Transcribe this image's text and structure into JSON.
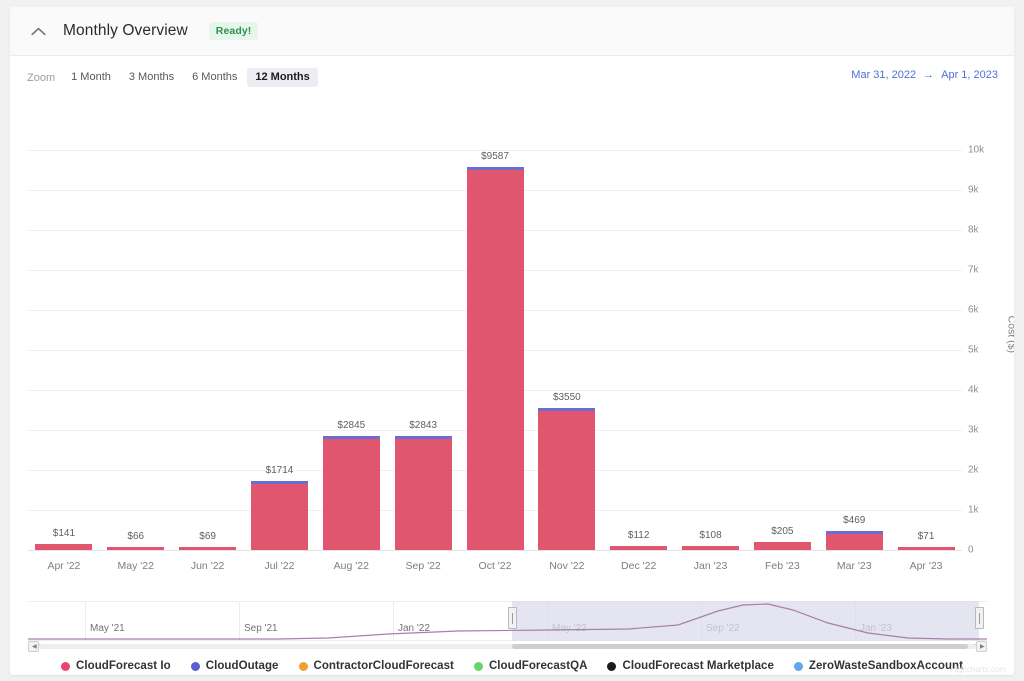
{
  "header": {
    "title": "Monthly Overview",
    "status": "Ready!",
    "collapse_icon": "chevron-up-icon"
  },
  "toolbar": {
    "zoom_label": "Zoom",
    "zoom_options": [
      {
        "label": "1 Month",
        "active": false
      },
      {
        "label": "3 Months",
        "active": false
      },
      {
        "label": "6 Months",
        "active": false
      },
      {
        "label": "12 Months",
        "active": true
      }
    ],
    "range_start": "Mar 31, 2022",
    "range_arrow": "→",
    "range_end": "Apr 1, 2023"
  },
  "chart_data": {
    "type": "bar",
    "title": "",
    "subtitle": "",
    "xlabel": "",
    "ylabel": "Cost ($)",
    "ylim": [
      0,
      10000
    ],
    "yticks": [
      "0",
      "1k",
      "2k",
      "3k",
      "4k",
      "5k",
      "6k",
      "7k",
      "8k",
      "9k",
      "10k"
    ],
    "grid": true,
    "legend_position": "bottom",
    "categories": [
      "Apr '22",
      "May '22",
      "Jun '22",
      "Jul '22",
      "Aug '22",
      "Sep '22",
      "Oct '22",
      "Nov '22",
      "Dec '22",
      "Jan '23",
      "Feb '23",
      "Mar '23",
      "Apr '23"
    ],
    "values": [
      141,
      66,
      69,
      1714,
      2845,
      2843,
      9587,
      3550,
      112,
      108,
      205,
      469,
      71
    ],
    "data_labels": [
      "$141",
      "$66",
      "$69",
      "$1714",
      "$2845",
      "$2843",
      "$9587",
      "$3550",
      "$112",
      "$108",
      "$205",
      "$469",
      "$71"
    ],
    "series": [
      {
        "name": "CloudForecast Io",
        "color": "#e0566f"
      },
      {
        "name": "CloudOutage",
        "color": "#6a6ed0"
      },
      {
        "name": "ContractorCloudForecast",
        "color": "#f0a02e"
      },
      {
        "name": "CloudForecastQA",
        "color": "#69d36c"
      },
      {
        "name": "CloudForecast Marketplace",
        "color": "#1c1c1e"
      },
      {
        "name": "ZeroWasteSandboxAccount",
        "color": "#61a6ea"
      }
    ]
  },
  "navigator": {
    "ticks": [
      "May '21",
      "Sep '21",
      "Jan '22",
      "May '22",
      "Sep '22",
      "Jan '23"
    ],
    "selection_start_pct": 50.5,
    "selection_end_pct": 99.2
  },
  "legend": [
    {
      "label": "CloudForecast Io",
      "color": "#e8456f"
    },
    {
      "label": "CloudOutage",
      "color": "#5b5fd1"
    },
    {
      "label": "ContractorCloudForecast",
      "color": "#f0a02e"
    },
    {
      "label": "CloudForecastQA",
      "color": "#69d36c"
    },
    {
      "label": "CloudForecast Marketplace",
      "color": "#1c1c1e"
    },
    {
      "label": "ZeroWasteSandboxAccount",
      "color": "#61a6ea"
    }
  ],
  "credits": "Highcharts.com"
}
